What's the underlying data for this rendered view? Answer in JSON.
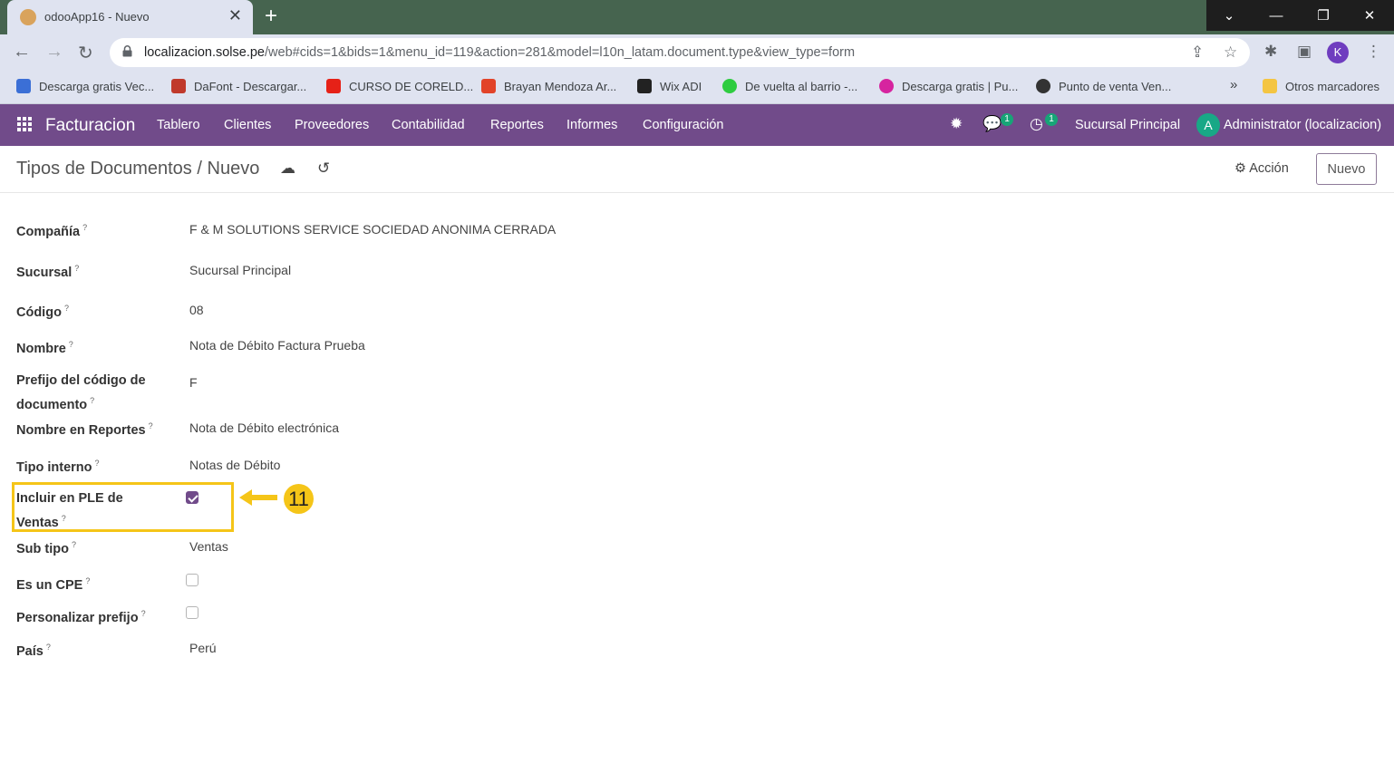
{
  "browser": {
    "tab_title": "odooApp16 - Nuevo",
    "url_host": "localizacion.solse.pe",
    "url_path": "/web#cids=1&bids=1&menu_id=119&action=281&model=l10n_latam.document.type&view_type=form",
    "profile_initial": "K",
    "bookmarks": [
      {
        "label": "Descarga gratis Vec...",
        "color": "#3b6fd6"
      },
      {
        "label": "DaFont - Descargar...",
        "color": "#c0392b"
      },
      {
        "label": "CURSO DE CORELD...",
        "color": "#e62117"
      },
      {
        "label": "Brayan Mendoza Ar...",
        "color": "#e24329"
      },
      {
        "label": "Wix ADI",
        "color": "#222222"
      },
      {
        "label": "De vuelta al barrio -...",
        "color": "#2ecc40"
      },
      {
        "label": "Descarga gratis | Pu...",
        "color": "#d6249f"
      },
      {
        "label": "Punto de venta Ven...",
        "color": "#333333"
      }
    ],
    "bookmarks_overflow": "»",
    "other_bookmarks": "Otros marcadores"
  },
  "navbar": {
    "brand": "Facturacion",
    "menu": [
      "Tablero",
      "Clientes",
      "Proveedores",
      "Contabilidad",
      "Reportes",
      "Informes",
      "Configuración"
    ],
    "messages_count": "1",
    "activities_count": "1",
    "branch": "Sucursal Principal",
    "avatar_initial": "A",
    "user": "Administrator (localizacion)",
    "accent_color": "#714b8a"
  },
  "control": {
    "breadcrumb_parent": "Tipos de Documentos",
    "breadcrumb_sep": "/",
    "breadcrumb_current": "Nuevo",
    "action_label": "Acción",
    "new_button": "Nuevo"
  },
  "form": {
    "company_label": "Compañía",
    "company_value": "F & M SOLUTIONS SERVICE SOCIEDAD ANONIMA CERRADA",
    "branch_label": "Sucursal",
    "branch_value": "Sucursal Principal",
    "code_label": "Código",
    "code_value": "08",
    "name_label": "Nombre",
    "name_value": "Nota de Débito Factura Prueba",
    "prefix_label": "Prefijo del código de documento",
    "prefix_value": "F",
    "report_name_label": "Nombre en Reportes",
    "report_name_value": "Nota de Débito electrónica",
    "internal_type_label": "Tipo interno",
    "internal_type_value": "Notas de Débito",
    "ple_label": "Incluir en PLE de Ventas",
    "ple_checked": true,
    "subtype_label": "Sub tipo",
    "subtype_value": "Ventas",
    "cpe_label": "Es un CPE",
    "cpe_checked": false,
    "custom_prefix_label": "Personalizar prefijo",
    "custom_prefix_checked": false,
    "country_label": "País",
    "country_value": "Perú",
    "tooltip_mark": "?"
  },
  "annotation": {
    "step_number": "11",
    "color": "#f5c518"
  }
}
